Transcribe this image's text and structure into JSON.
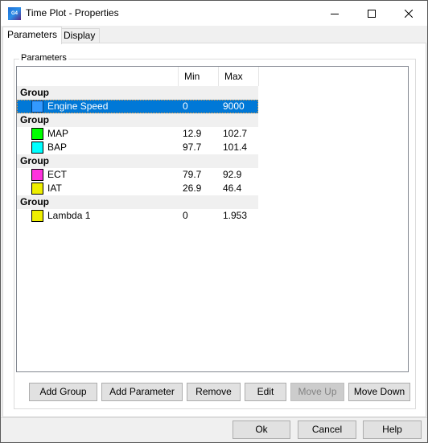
{
  "window": {
    "title": "Time Plot - Properties",
    "icon": "app-logo-icon",
    "icon_text": "G4"
  },
  "tabs": [
    {
      "label": "Parameters",
      "active": true
    },
    {
      "label": "Display",
      "active": false
    }
  ],
  "groupbox": {
    "label": "Parameters"
  },
  "list": {
    "columns": [
      "",
      "Min",
      "Max"
    ],
    "rows": [
      {
        "type": "group",
        "name": "Group"
      },
      {
        "type": "param",
        "name": "Engine Speed",
        "min": "0",
        "max": "9000",
        "color": "#3399ff",
        "selected": true
      },
      {
        "type": "group",
        "name": "Group"
      },
      {
        "type": "param",
        "name": "MAP",
        "min": "12.9",
        "max": "102.7",
        "color": "#00ff00"
      },
      {
        "type": "param",
        "name": "BAP",
        "min": "97.7",
        "max": "101.4",
        "color": "#00ffff"
      },
      {
        "type": "group",
        "name": "Group"
      },
      {
        "type": "param",
        "name": "ECT",
        "min": "79.7",
        "max": "92.9",
        "color": "#ff33dd"
      },
      {
        "type": "param",
        "name": "IAT",
        "min": "26.9",
        "max": "46.4",
        "color": "#eeee00"
      },
      {
        "type": "group",
        "name": "Group"
      },
      {
        "type": "param",
        "name": "Lambda 1",
        "min": "0",
        "max": "1.953",
        "color": "#eeee00"
      }
    ]
  },
  "actions": {
    "add_group": "Add Group",
    "add_parameter": "Add Parameter",
    "remove": "Remove",
    "edit": "Edit",
    "move_up": "Move Up",
    "move_down": "Move Down"
  },
  "footer": {
    "ok": "Ok",
    "cancel": "Cancel",
    "help": "Help"
  }
}
